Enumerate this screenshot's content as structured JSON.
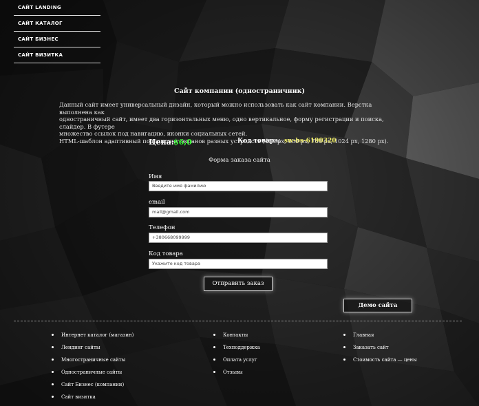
{
  "side_menu": [
    {
      "label": "САЙТ LANDING"
    },
    {
      "label": "САЙТ КАТАЛОГ"
    },
    {
      "label": "САЙТ БИЗНЕС"
    },
    {
      "label": "САЙТ ВИЗИТКА"
    }
  ],
  "product": {
    "title": "Сайт компании (одностраничник)",
    "description": [
      "Данный сайт имеет универсальный дизайн, который можно использовать как сайт компании. Верстка выполнена как",
      "одностраничный сайт, имеет два горизонтальных меню, одно вертикальное, форму регистрации и поиска, слайдер. В футере",
      "множество ссылок под навигацию, иконки социальных сетей.",
      "HTML-шаблон адаптивный под ширину экранов разных устройств (480 px, 600 px, 768 px, 1024 px, 1280 px)."
    ],
    "price_label": "Цена:",
    "price_value": "$6,0",
    "code_label": "Код товара:",
    "code_value": "sw-bs-6190320"
  },
  "order_form": {
    "title": "Форма заказа сайта",
    "fields": [
      {
        "label": "Имя",
        "placeholder": "Введите имя фамилию"
      },
      {
        "label": "email",
        "placeholder": "mail@gmail.com"
      },
      {
        "label": "Телефон",
        "placeholder": "+380668099999"
      },
      {
        "label": "Код товара",
        "placeholder": "Укажите код товара"
      }
    ],
    "submit_label": "Отправить заказ"
  },
  "demo_label": "Демо сайта",
  "footer": {
    "col1": [
      "Интернет каталог (магазин)",
      "Лендинг сайты",
      "Многостраничные сайты",
      "Одностраничные сайты",
      "Сайт Бизнес (компании)",
      "Сайт визитка"
    ],
    "col2": [
      "Контакты",
      "Техподдержка",
      "Оплата услуг",
      "Отзывы"
    ],
    "col3": [
      "Главная",
      "Заказать сайт",
      "Стоимость сайта — цены"
    ]
  },
  "colors": {
    "price": "#39ff35",
    "code": "#f3f06a",
    "background": "#141414"
  }
}
